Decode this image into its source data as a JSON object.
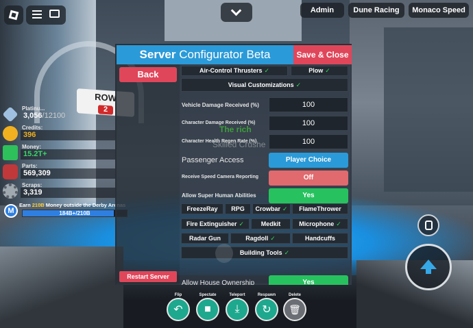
{
  "topbar": {
    "chevron": "chevron-down-icon",
    "pills": [
      "Admin",
      "Dune Racing",
      "Monaco Speed"
    ]
  },
  "world": {
    "row_sign": "ROW",
    "row_number": "2",
    "overlay_text": "The rich"
  },
  "stats": [
    {
      "label": "Platinu...",
      "value": "3,056",
      "max": "/12100",
      "color": "#9fc0e0"
    },
    {
      "label": "Credits:",
      "value": "396",
      "color": "#f0b020"
    },
    {
      "label": "Money:",
      "value": "15.2T+",
      "color": "#2ec05a"
    },
    {
      "label": "Parts:",
      "value": "569,309",
      "color": "#c0383a"
    },
    {
      "label": "Scraps:",
      "value": "3,319",
      "color": "#a0a8b0"
    }
  ],
  "quest": {
    "text_pre": "Earn ",
    "text_hl": "210B",
    "text_post": " Money outside the Derby Arenas",
    "progress": "184B+/210B",
    "badge": "M",
    "fraction": 0.876
  },
  "panel": {
    "title_bold": "Server",
    "title_rest": " Configurator Beta",
    "save": "Save & Close",
    "back": "Back",
    "restart": "Restart Server",
    "toggles_top": [
      {
        "label": "Air-Control Thrusters",
        "on": true
      },
      {
        "label": "Plow",
        "on": true
      }
    ],
    "visual": "Visual Customizations",
    "numeric": [
      {
        "label": "Vehicle Damage Received (%)",
        "value": "100"
      },
      {
        "label": "Character Damage Received (%)",
        "value": "100"
      },
      {
        "label": "Character Health Regen Rate (%)",
        "value": "100"
      }
    ],
    "passenger_label": "Passenger Access",
    "passenger_value": "Player Choice",
    "speedcam_label": "Receive Speed Camera Reporting",
    "speedcam_value": "Off",
    "superhuman_label": "Allow Super Human Abilities",
    "superhuman_value": "Yes",
    "tools": [
      [
        {
          "label": "FreezeRay",
          "on": false
        },
        {
          "label": "RPG",
          "on": false
        },
        {
          "label": "Crowbar",
          "on": true
        },
        {
          "label": "FlameThrower",
          "on": false
        }
      ],
      [
        {
          "label": "Fire Extinguisher",
          "on": true
        },
        {
          "label": "Medkit",
          "on": false
        },
        {
          "label": "Microphone",
          "on": true
        }
      ],
      [
        {
          "label": "Radar Gun",
          "on": false
        },
        {
          "label": "Ragdoll",
          "on": true
        },
        {
          "label": "Handcuffs",
          "on": false
        }
      ]
    ],
    "building": "Building Tools",
    "house_label": "Allow House Ownership",
    "house_value": "Yes",
    "ghost_text": "Skilled Crushe",
    "check": "✓"
  },
  "bottom": [
    {
      "label": "Flip",
      "icon": "undo-arrow-icon",
      "glyph": "↶"
    },
    {
      "label": "Spectate",
      "icon": "camera-icon",
      "glyph": "■"
    },
    {
      "label": "Teleport",
      "icon": "download-icon",
      "glyph": "⤓"
    },
    {
      "label": "Respawn",
      "icon": "refresh-icon",
      "glyph": "↻"
    },
    {
      "label": "Delete",
      "icon": "trash-icon",
      "glyph": "🗑"
    }
  ],
  "colors": {
    "accent_blue": "#2b9ad8",
    "danger_red": "#e0465a",
    "yes_green": "#27c25f",
    "off_red": "#e06a6e",
    "tool_teal": "#1ea88e"
  }
}
